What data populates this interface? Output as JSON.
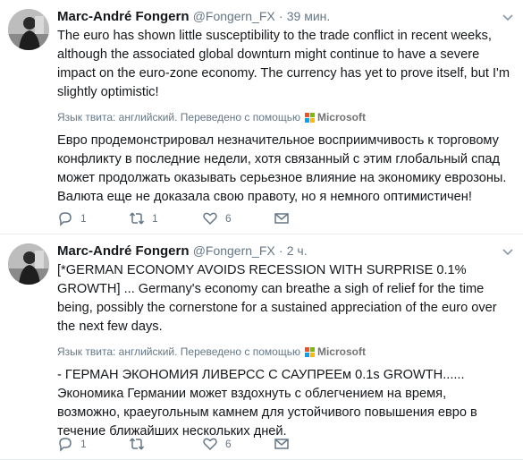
{
  "tweets": [
    {
      "name": "Marc-André Fongern",
      "handle": "@Fongern_FX",
      "separator": "·",
      "time": "39 мин.",
      "text": "The euro has shown little susceptibility to the trade conflict in recent weeks, although the associated global downturn might continue to have a severe impact on the euro-zone economy. The currency has yet to prove itself, but I'm slightly optimistic!",
      "translation_label": "Язык твита: английский. Переведено с помощью",
      "translator": "Microsoft",
      "translation": "Евро продемонстрировал незначительное восприимчивость к торговому конфликту в последние недели, хотя связанный с этим глобальный спад может продолжать оказывать серьезное влияние на экономику еврозоны. Валюта еще не доказала свою правоту, но я немного оптимистичен!",
      "replies": "1",
      "retweets": "1",
      "likes": "6"
    },
    {
      "name": "Marc-André Fongern",
      "handle": "@Fongern_FX",
      "separator": "·",
      "time": "2 ч.",
      "text": "[*GERMAN ECONOMY AVOIDS RECESSION WITH SURPRISE 0.1% GROWTH] ... Germany's economy can breathe a sigh of relief for the time being, possibly the cornerstone for a sustained appreciation of the euro over the next few days.",
      "translation_label": "Язык твита: английский. Переведено с помощью",
      "translator": "Microsoft",
      "translation": "- ГЕРМАН ЭКОНОМИЯ ЛИВЕРСС С САУПРЕЕм 0.1s GROWTH...... Экономика Германии может вздохнуть с облегчением на время, возможно, краеугольным камнем для устойчивого повышения евро в течение ближайших нескольких дней.",
      "replies": "1",
      "retweets": "",
      "likes": "6"
    }
  ],
  "colors": {
    "text": "#14171a",
    "secondary": "#657786",
    "border": "#e6ecf0",
    "ms_red": "#f25022",
    "ms_green": "#7fba00",
    "ms_blue": "#00a4ef",
    "ms_yellow": "#ffb900"
  }
}
